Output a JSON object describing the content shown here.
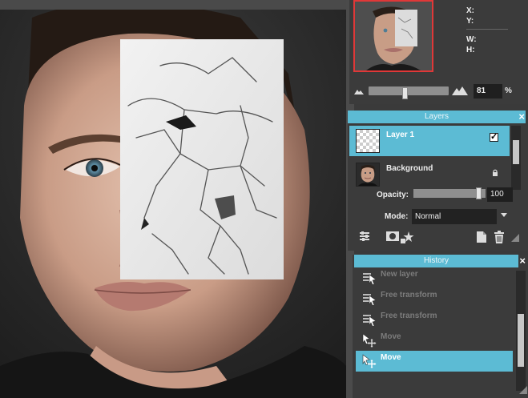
{
  "navigator": {
    "x_label": "X:",
    "y_label": "Y:",
    "w_label": "W:",
    "h_label": "H:",
    "zoom_value": "81",
    "zoom_unit": "%",
    "zoom_level_fraction": 0.18
  },
  "layers": {
    "title": "Layers",
    "close": "×",
    "items": [
      {
        "name": "Layer 1",
        "visible_check": "✓",
        "selected": true
      },
      {
        "name": "Background",
        "locked": true
      }
    ],
    "opacity_label": "Opacity:",
    "opacity_value": "100",
    "mode_label": "Mode:",
    "mode_value": "Normal"
  },
  "history": {
    "title": "History",
    "close": "×",
    "items": [
      {
        "label": "New layer",
        "icon": "layer-add-icon"
      },
      {
        "label": "Free transform",
        "icon": "layer-add-icon"
      },
      {
        "label": "Free transform",
        "icon": "layer-add-icon"
      },
      {
        "label": "Move",
        "icon": "move-icon"
      },
      {
        "label": "Move",
        "icon": "move-icon"
      }
    ]
  },
  "colors": {
    "accent": "#5cbbd4",
    "panel_bg": "#3b3b3b",
    "nav_frame": "#e03838"
  }
}
